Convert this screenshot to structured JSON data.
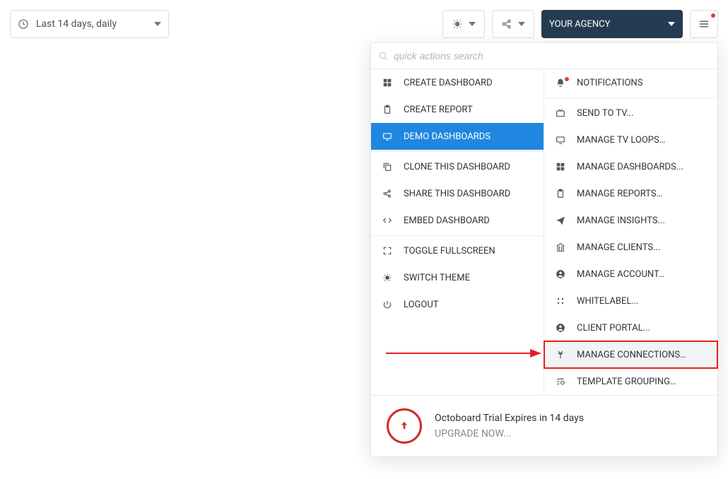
{
  "topbar": {
    "date_range": "Last 14 days, daily",
    "agency_label": "YOUR AGENCY"
  },
  "search": {
    "placeholder": "quick actions search"
  },
  "left_col": [
    {
      "icon": "grid",
      "label": "CREATE DASHBOARD"
    },
    {
      "icon": "clipboard",
      "label": "CREATE REPORT"
    },
    {
      "icon": "monitor",
      "label": "DEMO DASHBOARDS",
      "selected": true
    },
    {
      "divider": true
    },
    {
      "icon": "copy",
      "label": "CLONE THIS DASHBOARD"
    },
    {
      "icon": "share",
      "label": "SHARE THIS DASHBOARD"
    },
    {
      "icon": "code",
      "label": "EMBED DASHBOARD"
    },
    {
      "divider": true
    },
    {
      "icon": "fullscreen",
      "label": "TOGGLE FULLSCREEN"
    },
    {
      "icon": "theme",
      "label": "SWITCH THEME"
    },
    {
      "icon": "power",
      "label": "LOGOUT"
    }
  ],
  "right_col": [
    {
      "icon": "bell",
      "label": "NOTIFICATIONS",
      "badge": true
    },
    {
      "divider": true
    },
    {
      "icon": "tv",
      "label": "SEND TO TV..."
    },
    {
      "icon": "monitor",
      "label": "MANAGE TV LOOPS…"
    },
    {
      "icon": "grid",
      "label": "MANAGE DASHBOARDS..."
    },
    {
      "icon": "clipboard",
      "label": "MANAGE REPORTS…"
    },
    {
      "icon": "send",
      "label": "MANAGE INSIGHTS..."
    },
    {
      "icon": "bank",
      "label": "MANAGE CLIENTS..."
    },
    {
      "icon": "user",
      "label": "MANAGE ACCOUNT…"
    },
    {
      "icon": "dots",
      "label": "WHITELABEL..."
    },
    {
      "icon": "user",
      "label": "CLIENT PORTAL..."
    },
    {
      "icon": "plug",
      "label": "MANAGE CONNECTIONS…",
      "highlighted": true
    },
    {
      "icon": "template",
      "label": "TEMPLATE GROUPING…"
    }
  ],
  "trial": {
    "text": "Octoboard Trial Expires in 14 days",
    "upgrade": "UPGRADE NOW..."
  }
}
